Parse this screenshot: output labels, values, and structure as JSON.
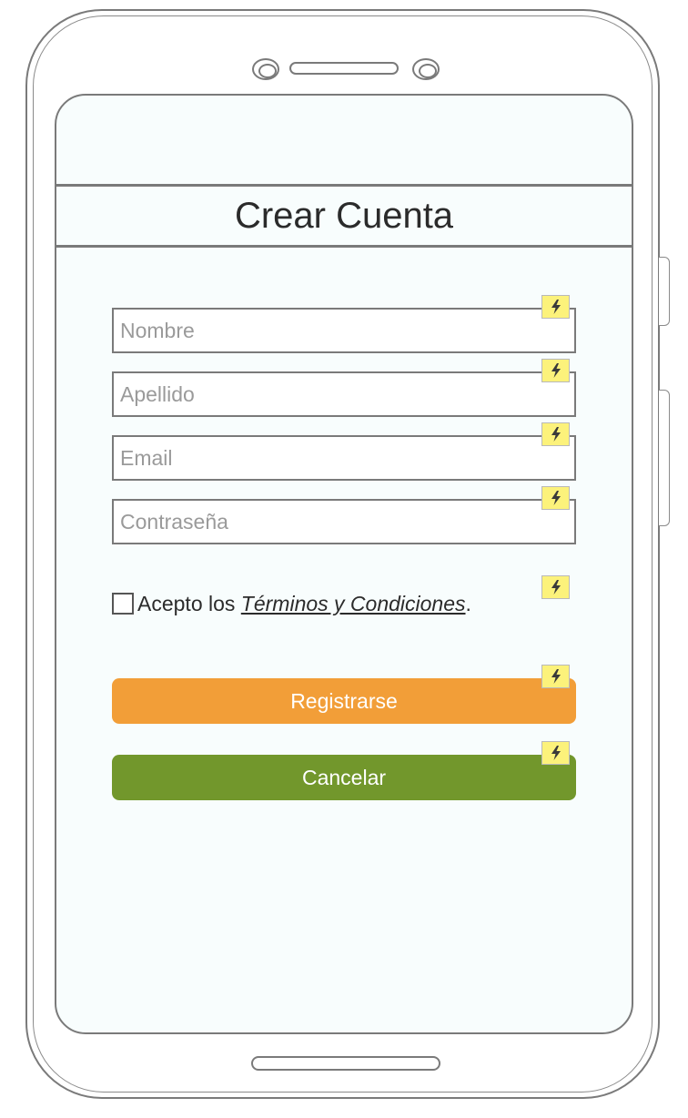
{
  "title": "Crear Cuenta",
  "fields": [
    {
      "placeholder": "Nombre",
      "value": ""
    },
    {
      "placeholder": "Apellido",
      "value": ""
    },
    {
      "placeholder": "Email",
      "value": ""
    },
    {
      "placeholder": "Contraseña",
      "value": ""
    }
  ],
  "terms": {
    "checked": false,
    "prefix": "Acepto los ",
    "link": "Términos y Condiciones",
    "suffix": "."
  },
  "buttons": {
    "register": "Registrarse",
    "cancel": "Cancelar"
  },
  "colors": {
    "register": "#f29e38",
    "cancel": "#72972c",
    "flash_badge": "#fcf27b",
    "screen_bg": "#f8fdfd"
  },
  "icons": {
    "flash": "lightning-bolt-icon"
  }
}
